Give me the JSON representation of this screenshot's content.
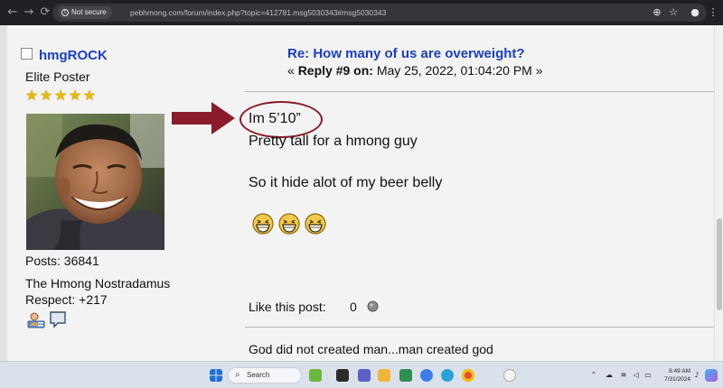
{
  "browser": {
    "back_glyph": "←",
    "forward_glyph": "→",
    "reload_glyph": "⟳",
    "security_label": "Not secure",
    "url": "pebhmong.com/forum/index.php?topic=412781.msg5030343#msg5030343",
    "zoom_glyph": "⊕",
    "bookmark_glyph": "☆",
    "profile_glyph": "●",
    "menu_glyph": "⋮"
  },
  "poster": {
    "username": "hmgROCK",
    "rank": "Elite Poster",
    "stars": [
      "★",
      "★",
      "★",
      "★",
      "★"
    ],
    "posts": "Posts: 36841",
    "custom_title": "The Hmong Nostradamus",
    "respect": "Respect: +217",
    "icons": [
      "profile-icon",
      "personal-message-icon"
    ]
  },
  "post": {
    "title": "Re: How many of us are overweight?",
    "meta_open": "« ",
    "reply_label": "Reply #9 on:",
    "date": " May 25, 2022, 01:04:20 PM",
    "meta_close": " »",
    "body": {
      "line1": "Im 5’10”",
      "line2": "Pretty tall for a hmong guy",
      "line3": "So it hide alot of my beer belly"
    },
    "smilies": [
      "laughing-smiley-icon",
      "laughing-smiley-icon",
      "laughing-smiley-icon"
    ],
    "like_label": "Like this post:",
    "like_count": "0",
    "signature": "God did not created man...man created god"
  },
  "annotation": {
    "arrow_color": "#8b1b2a",
    "circle_color": "#8b1b2a"
  },
  "taskbar": {
    "search_label": "Search",
    "time": "8:49 AM",
    "date": "7/31/2024"
  },
  "colors": {
    "link_blue": "#1a3fc1",
    "page_bg": "#f3f3f3",
    "chrome_bg": "#202124"
  }
}
